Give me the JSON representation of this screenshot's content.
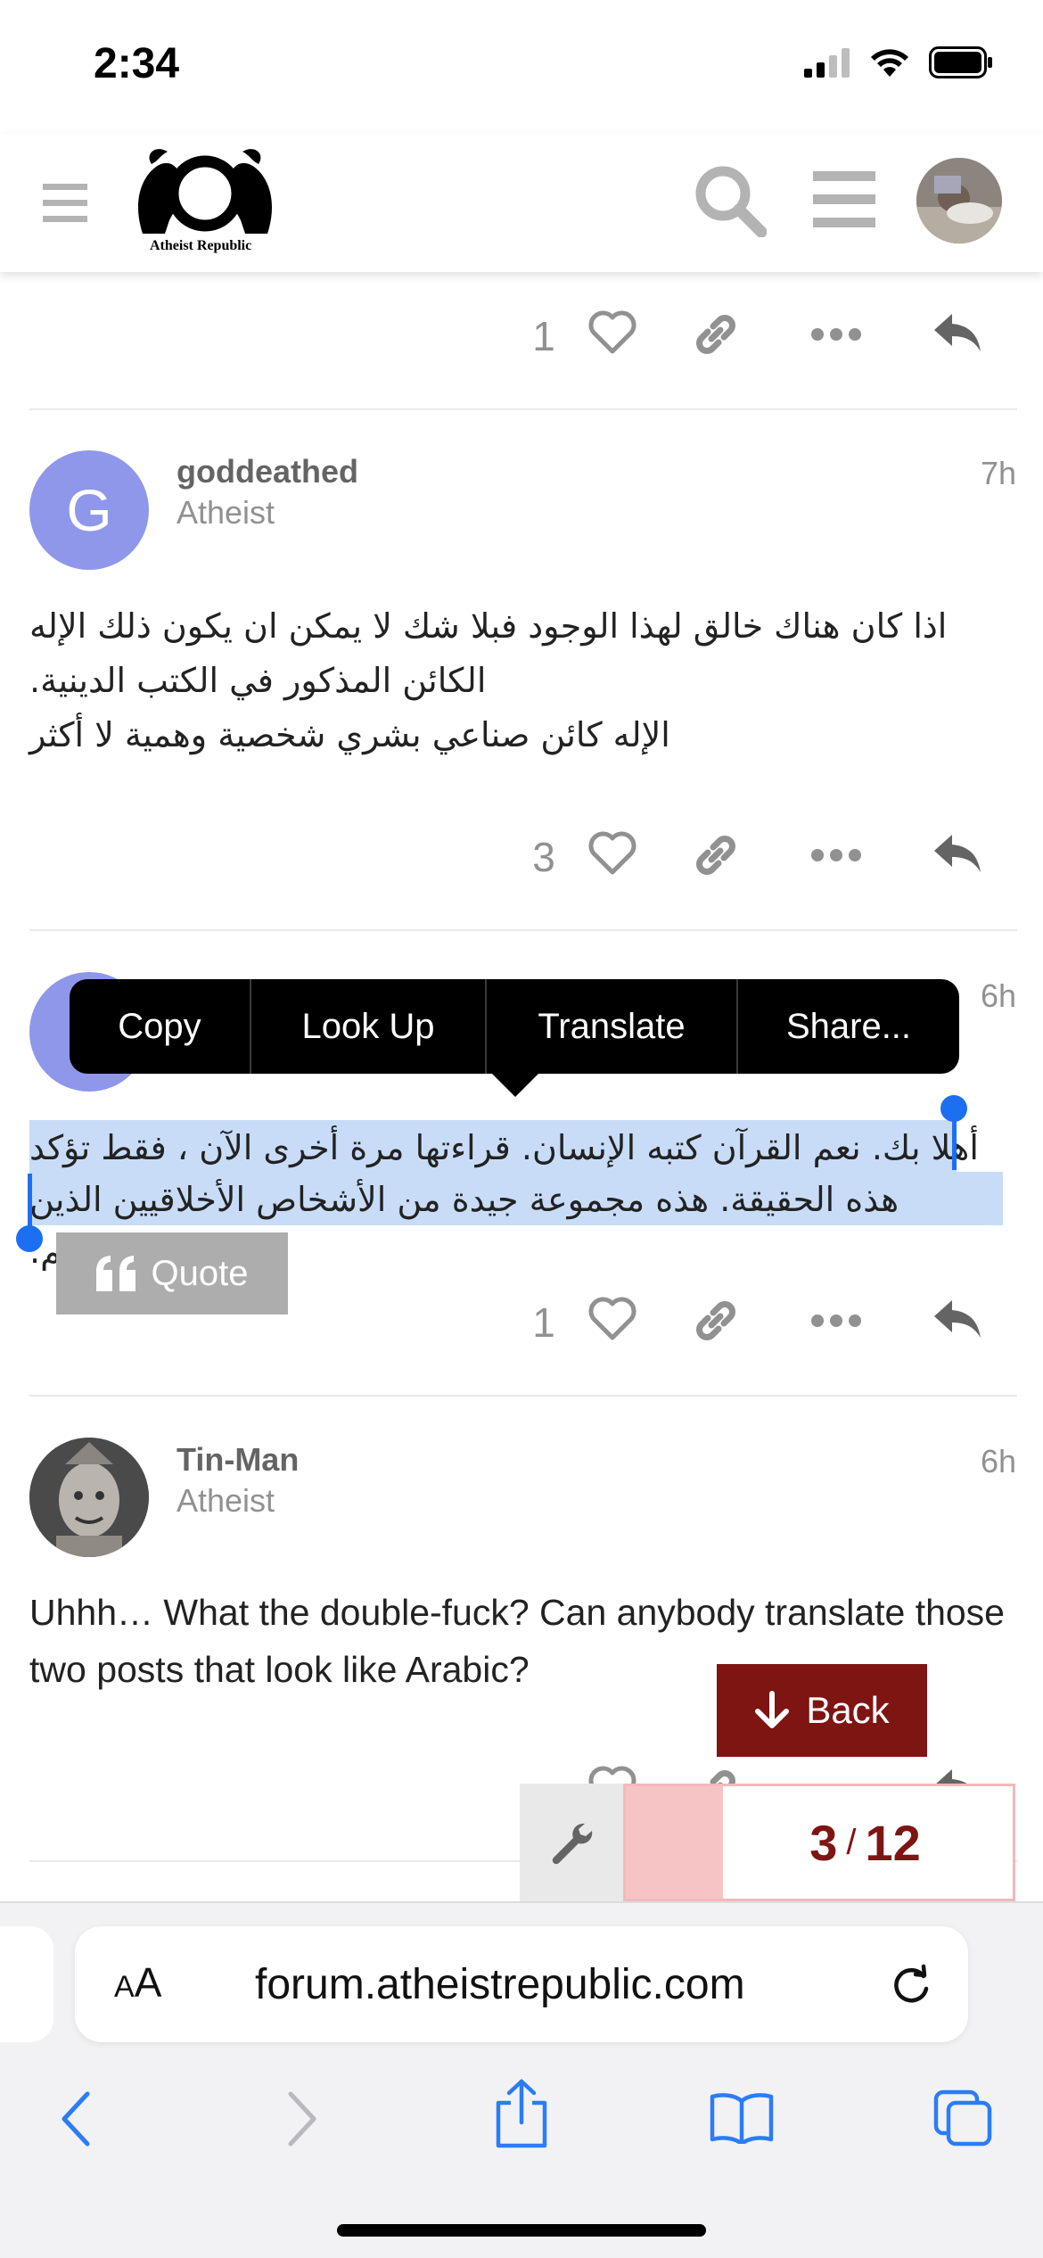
{
  "status_bar": {
    "time": "2:34"
  },
  "header": {
    "logo_text": "Atheist Republic"
  },
  "posts": [
    {
      "like_count": "1"
    },
    {
      "avatar_letter": "G",
      "avatar_color": "#8e97ea",
      "username": "goddeathed",
      "user_title": "Atheist",
      "time": "7h",
      "body_lines": [
        "اذا كان هناك خالق لهذا الوجود فبلا شك لا يمكن ان يكون ذلك الإله",
        "الكائن المذكور في الكتب الدينية.",
        "الإله كائن صناعي بشري شخصية وهمية لا أكثر"
      ],
      "like_count": "3"
    },
    {
      "avatar_color": "#8e97ea",
      "time": "6h",
      "body_lines": [
        "أهلا بك. نعم القرآن كتبه الإنسان. قراءتها مرة أخرى الآن ، فقط تؤكد",
        "هذه الحقيقة. هذه مجموعة جيدة من الأشخاص الأخلاقيين الذين وجدتهم."
      ],
      "like_count": "1"
    },
    {
      "username": "Tin-Man",
      "user_title": "Atheist",
      "time": "6h",
      "body": "Uhhh… What the double-fuck? Can anybody translate those two posts that look like Arabic?"
    }
  ],
  "callout_menu": [
    "Copy",
    "Look Up",
    "Translate",
    "Share..."
  ],
  "quote_button": "Quote",
  "back_button": "Back",
  "progress": {
    "current": "3",
    "total": "12",
    "fraction": 0.25
  },
  "browser": {
    "aa_label_small": "A",
    "aa_label_large": "A",
    "url": "forum.atheistrepublic.com"
  },
  "colors": {
    "accent": "#7e1513",
    "selection": "#c8dcf8",
    "handle": "#1d6ff2"
  }
}
